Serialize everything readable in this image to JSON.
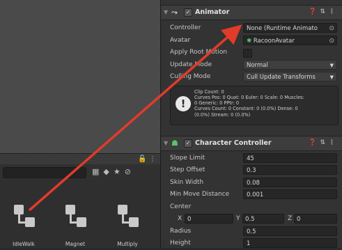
{
  "project": {
    "assets": [
      {
        "label": "IdleWalk"
      },
      {
        "label": "Magnet"
      },
      {
        "label": "Multiply"
      }
    ]
  },
  "animator": {
    "title": "Animator",
    "rows": [
      {
        "label": "Controller",
        "value": "None (Runtime Animato"
      },
      {
        "label": "Avatar",
        "value": "RacoonAvatar"
      },
      {
        "label": "Apply Root Motion"
      },
      {
        "label": "Update Mode",
        "value": "Normal"
      },
      {
        "label": "Culling Mode",
        "value": "Cull Update Transforms"
      }
    ],
    "info_lines": [
      "Clip Count: 0",
      "Curves Pos: 0 Quat: 0 Euler: 0 Scale: 0 Muscles:",
      "0 Generic: 0 PPtr: 0",
      "Curves Count: 0 Constant: 0 (0.0%) Dense: 0",
      "(0.0%) Stream: 0 (0.0%)"
    ]
  },
  "character_controller": {
    "title": "Character Controller",
    "rows": [
      {
        "label": "Slope Limit",
        "value": "45"
      },
      {
        "label": "Step Offset",
        "value": "0.3"
      },
      {
        "label": "Skin Width",
        "value": "0.08"
      },
      {
        "label": "Min Move Distance",
        "value": "0.001"
      }
    ],
    "center_label": "Center",
    "center": {
      "x_label": "X",
      "x": "0",
      "y_label": "Y",
      "y": "0.5",
      "z_label": "Z",
      "z": "0"
    },
    "radius_label": "Radius",
    "radius": "0.5",
    "height_label": "Height",
    "height": "1"
  },
  "colors": {
    "arrow": "#e23b2a",
    "panel": "#333333",
    "accent": "#5cc36b"
  }
}
